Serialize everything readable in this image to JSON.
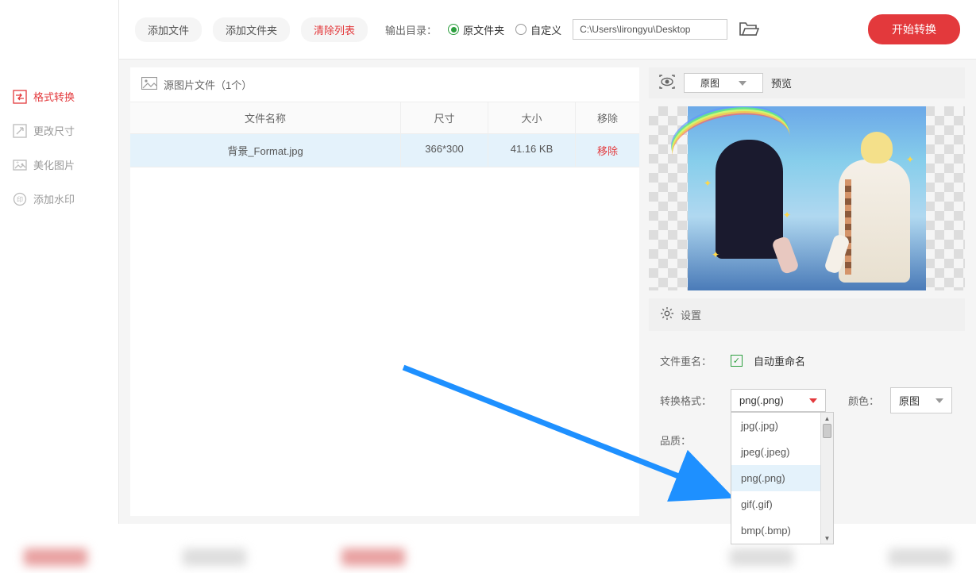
{
  "sidebar": {
    "items": [
      {
        "label": "格式转换",
        "icon": "convert"
      },
      {
        "label": "更改尺寸",
        "icon": "resize"
      },
      {
        "label": "美化图片",
        "icon": "beautify"
      },
      {
        "label": "添加水印",
        "icon": "watermark"
      }
    ]
  },
  "toolbar": {
    "add_file": "添加文件",
    "add_folder": "添加文件夹",
    "clear_list": "清除列表",
    "output_label": "输出目录：",
    "original_folder": "原文件夹",
    "custom": "自定义",
    "path": "C:\\Users\\lirongyu\\Desktop",
    "start": "开始转换"
  },
  "file_panel": {
    "title": "源图片文件（1个）",
    "headers": {
      "name": "文件名称",
      "dimension": "尺寸",
      "size": "大小",
      "remove": "移除"
    },
    "rows": [
      {
        "name": "背景_Format.jpg",
        "dimension": "366*300",
        "size": "41.16 KB",
        "remove": "移除"
      }
    ]
  },
  "preview": {
    "select_label": "原图",
    "label": "预览"
  },
  "settings": {
    "title": "设置",
    "rename_label": "文件重名：",
    "rename_auto": "自动重命名",
    "format_label": "转换格式：",
    "format_value": "png(.png)",
    "color_label": "颜色：",
    "color_value": "原图",
    "quality_label": "品质：",
    "format_options": [
      "jpg(.jpg)",
      "jpeg(.jpeg)",
      "png(.png)",
      "gif(.gif)",
      "bmp(.bmp)"
    ]
  }
}
